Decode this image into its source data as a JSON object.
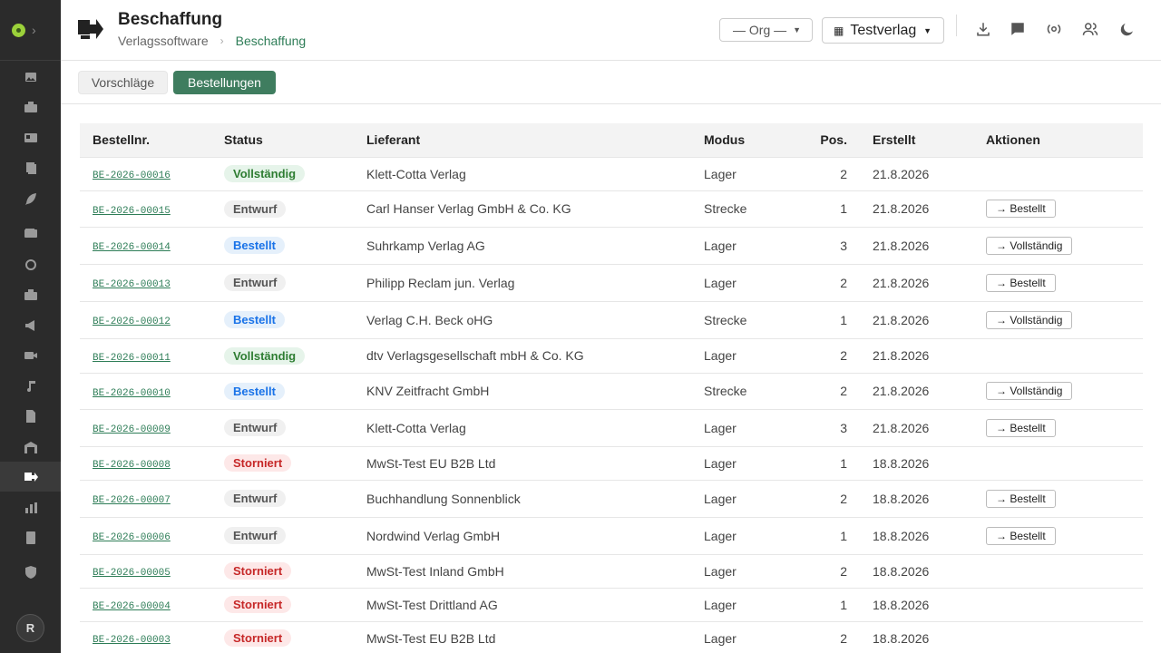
{
  "sidebar": {
    "items": [
      {
        "icon": "image-icon"
      },
      {
        "icon": "briefcase-icon"
      },
      {
        "icon": "id-card-icon"
      },
      {
        "icon": "book-stack-icon"
      },
      {
        "icon": "feather-icon"
      },
      {
        "icon": "wallet-icon"
      },
      {
        "icon": "sync-icon"
      },
      {
        "icon": "suitcase-icon"
      },
      {
        "icon": "megaphone-icon"
      },
      {
        "icon": "video-icon"
      },
      {
        "icon": "music-note-icon"
      },
      {
        "icon": "document-icon"
      },
      {
        "icon": "warehouse-icon"
      },
      {
        "icon": "procurement-icon"
      },
      {
        "icon": "bar-chart-icon"
      },
      {
        "icon": "ledger-icon"
      },
      {
        "icon": "shield-icon"
      }
    ],
    "active_index": 13,
    "avatar": "R"
  },
  "header": {
    "title": "Beschaffung",
    "breadcrumb": [
      "Verlagssoftware",
      "Beschaffung"
    ],
    "org_select": "— Org —",
    "publisher_select": "Testverlag"
  },
  "tabs": [
    {
      "label": "Vorschläge",
      "active": false
    },
    {
      "label": "Bestellungen",
      "active": true
    }
  ],
  "table": {
    "headers": [
      "Bestellnr.",
      "Status",
      "Lieferant",
      "Modus",
      "Pos.",
      "Erstellt",
      "Aktionen"
    ],
    "rows": [
      {
        "id": "BE-2026-00016",
        "status": "Vollständig",
        "status_key": "vollstandig",
        "supplier": "Klett-Cotta Verlag",
        "mode": "Lager",
        "pos": "2",
        "created": "21.8.2026",
        "action": ""
      },
      {
        "id": "BE-2026-00015",
        "status": "Entwurf",
        "status_key": "entwurf",
        "supplier": "Carl Hanser Verlag GmbH & Co. KG",
        "mode": "Strecke",
        "pos": "1",
        "created": "21.8.2026",
        "action": "→ Bestellt"
      },
      {
        "id": "BE-2026-00014",
        "status": "Bestellt",
        "status_key": "bestellt",
        "supplier": "Suhrkamp Verlag AG",
        "mode": "Lager",
        "pos": "3",
        "created": "21.8.2026",
        "action": "→ Vollständig"
      },
      {
        "id": "BE-2026-00013",
        "status": "Entwurf",
        "status_key": "entwurf",
        "supplier": "Philipp Reclam jun. Verlag",
        "mode": "Lager",
        "pos": "2",
        "created": "21.8.2026",
        "action": "→ Bestellt"
      },
      {
        "id": "BE-2026-00012",
        "status": "Bestellt",
        "status_key": "bestellt",
        "supplier": "Verlag C.H. Beck oHG",
        "mode": "Strecke",
        "pos": "1",
        "created": "21.8.2026",
        "action": "→ Vollständig"
      },
      {
        "id": "BE-2026-00011",
        "status": "Vollständig",
        "status_key": "vollstandig",
        "supplier": "dtv Verlagsgesellschaft mbH & Co. KG",
        "mode": "Lager",
        "pos": "2",
        "created": "21.8.2026",
        "action": ""
      },
      {
        "id": "BE-2026-00010",
        "status": "Bestellt",
        "status_key": "bestellt",
        "supplier": "KNV Zeitfracht GmbH",
        "mode": "Strecke",
        "pos": "2",
        "created": "21.8.2026",
        "action": "→ Vollständig"
      },
      {
        "id": "BE-2026-00009",
        "status": "Entwurf",
        "status_key": "entwurf",
        "supplier": "Klett-Cotta Verlag",
        "mode": "Lager",
        "pos": "3",
        "created": "21.8.2026",
        "action": "→ Bestellt"
      },
      {
        "id": "BE-2026-00008",
        "status": "Storniert",
        "status_key": "storniert",
        "supplier": "MwSt-Test EU B2B Ltd",
        "mode": "Lager",
        "pos": "1",
        "created": "18.8.2026",
        "action": ""
      },
      {
        "id": "BE-2026-00007",
        "status": "Entwurf",
        "status_key": "entwurf",
        "supplier": "Buchhandlung Sonnenblick",
        "mode": "Lager",
        "pos": "2",
        "created": "18.8.2026",
        "action": "→ Bestellt"
      },
      {
        "id": "BE-2026-00006",
        "status": "Entwurf",
        "status_key": "entwurf",
        "supplier": "Nordwind Verlag GmbH",
        "mode": "Lager",
        "pos": "1",
        "created": "18.8.2026",
        "action": "→ Bestellt"
      },
      {
        "id": "BE-2026-00005",
        "status": "Storniert",
        "status_key": "storniert",
        "supplier": "MwSt-Test Inland GmbH",
        "mode": "Lager",
        "pos": "2",
        "created": "18.8.2026",
        "action": ""
      },
      {
        "id": "BE-2026-00004",
        "status": "Storniert",
        "status_key": "storniert",
        "supplier": "MwSt-Test Drittland AG",
        "mode": "Lager",
        "pos": "1",
        "created": "18.8.2026",
        "action": ""
      },
      {
        "id": "BE-2026-00003",
        "status": "Storniert",
        "status_key": "storniert",
        "supplier": "MwSt-Test EU B2B Ltd",
        "mode": "Lager",
        "pos": "2",
        "created": "18.8.2026",
        "action": ""
      }
    ]
  },
  "colors": {
    "accent": "#3f7d5f",
    "link": "#2e7d57",
    "sidebar_bg": "#2b2b2b"
  }
}
